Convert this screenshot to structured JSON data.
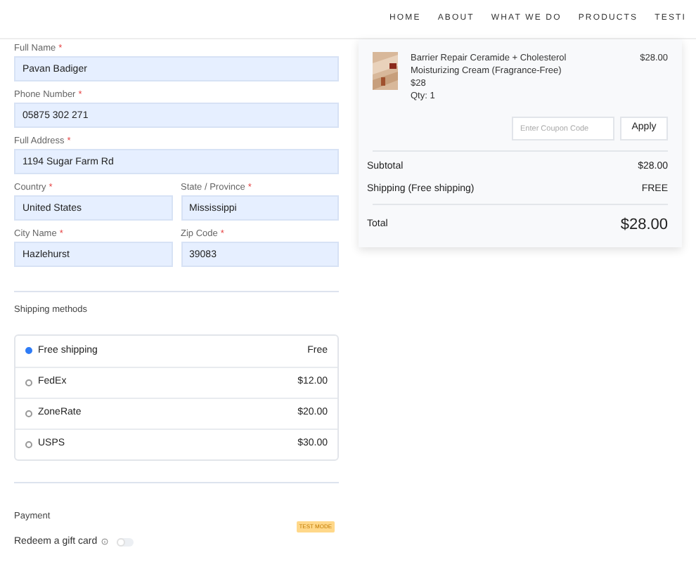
{
  "nav": [
    "HOME",
    "ABOUT",
    "WHAT WE DO",
    "PRODUCTS",
    "TESTI"
  ],
  "field_rows": [
    [
      {
        "label": "Full Name",
        "mark": "*",
        "value": "Pavan Badiger"
      }
    ],
    [
      {
        "label": "Phone Number",
        "mark": "*",
        "value": "05875 302 271"
      }
    ],
    [
      {
        "label": "Full Address",
        "mark": "*",
        "value": "1194 Sugar Farm Rd"
      }
    ],
    [
      {
        "label": "Country",
        "mark": "*",
        "value": "United States"
      },
      {
        "label": "State / Province",
        "mark": "*",
        "value": "Mississippi"
      }
    ],
    [
      {
        "label": "City Name",
        "mark": "*",
        "value": "Hazlehurst"
      },
      {
        "label": "Zip Code",
        "mark": "*",
        "value": "39083"
      }
    ]
  ],
  "shipping": {
    "title": "Shipping methods",
    "options": [
      {
        "name": "Free shipping",
        "price": "Free",
        "selected": true
      },
      {
        "name": "FedEx",
        "price": "$12.00",
        "selected": false
      },
      {
        "name": "ZoneRate",
        "price": "$20.00",
        "selected": false
      },
      {
        "name": "USPS",
        "price": "$30.00",
        "selected": false
      }
    ]
  },
  "payment": {
    "title": "Payment",
    "badge": "TEST MODE",
    "gift_card": {
      "label": "Redeem a gift card",
      "on": false
    }
  },
  "order": {
    "item": {
      "name": "Barrier Repair Ceramide + Cholesterol Moisturizing Cream (Fragrance-Free)",
      "unit_price": "$28",
      "qty": "Qty: 1",
      "total": "$28.00"
    },
    "coupon": {
      "placeholder": "Enter Coupon Code",
      "button": "Apply"
    },
    "lines": [
      {
        "label": "Subtotal",
        "value": "$28.00"
      },
      {
        "label": "Shipping (Free shipping)",
        "value": "FREE"
      }
    ],
    "total": {
      "label": "Total",
      "value": "$28.00"
    }
  }
}
